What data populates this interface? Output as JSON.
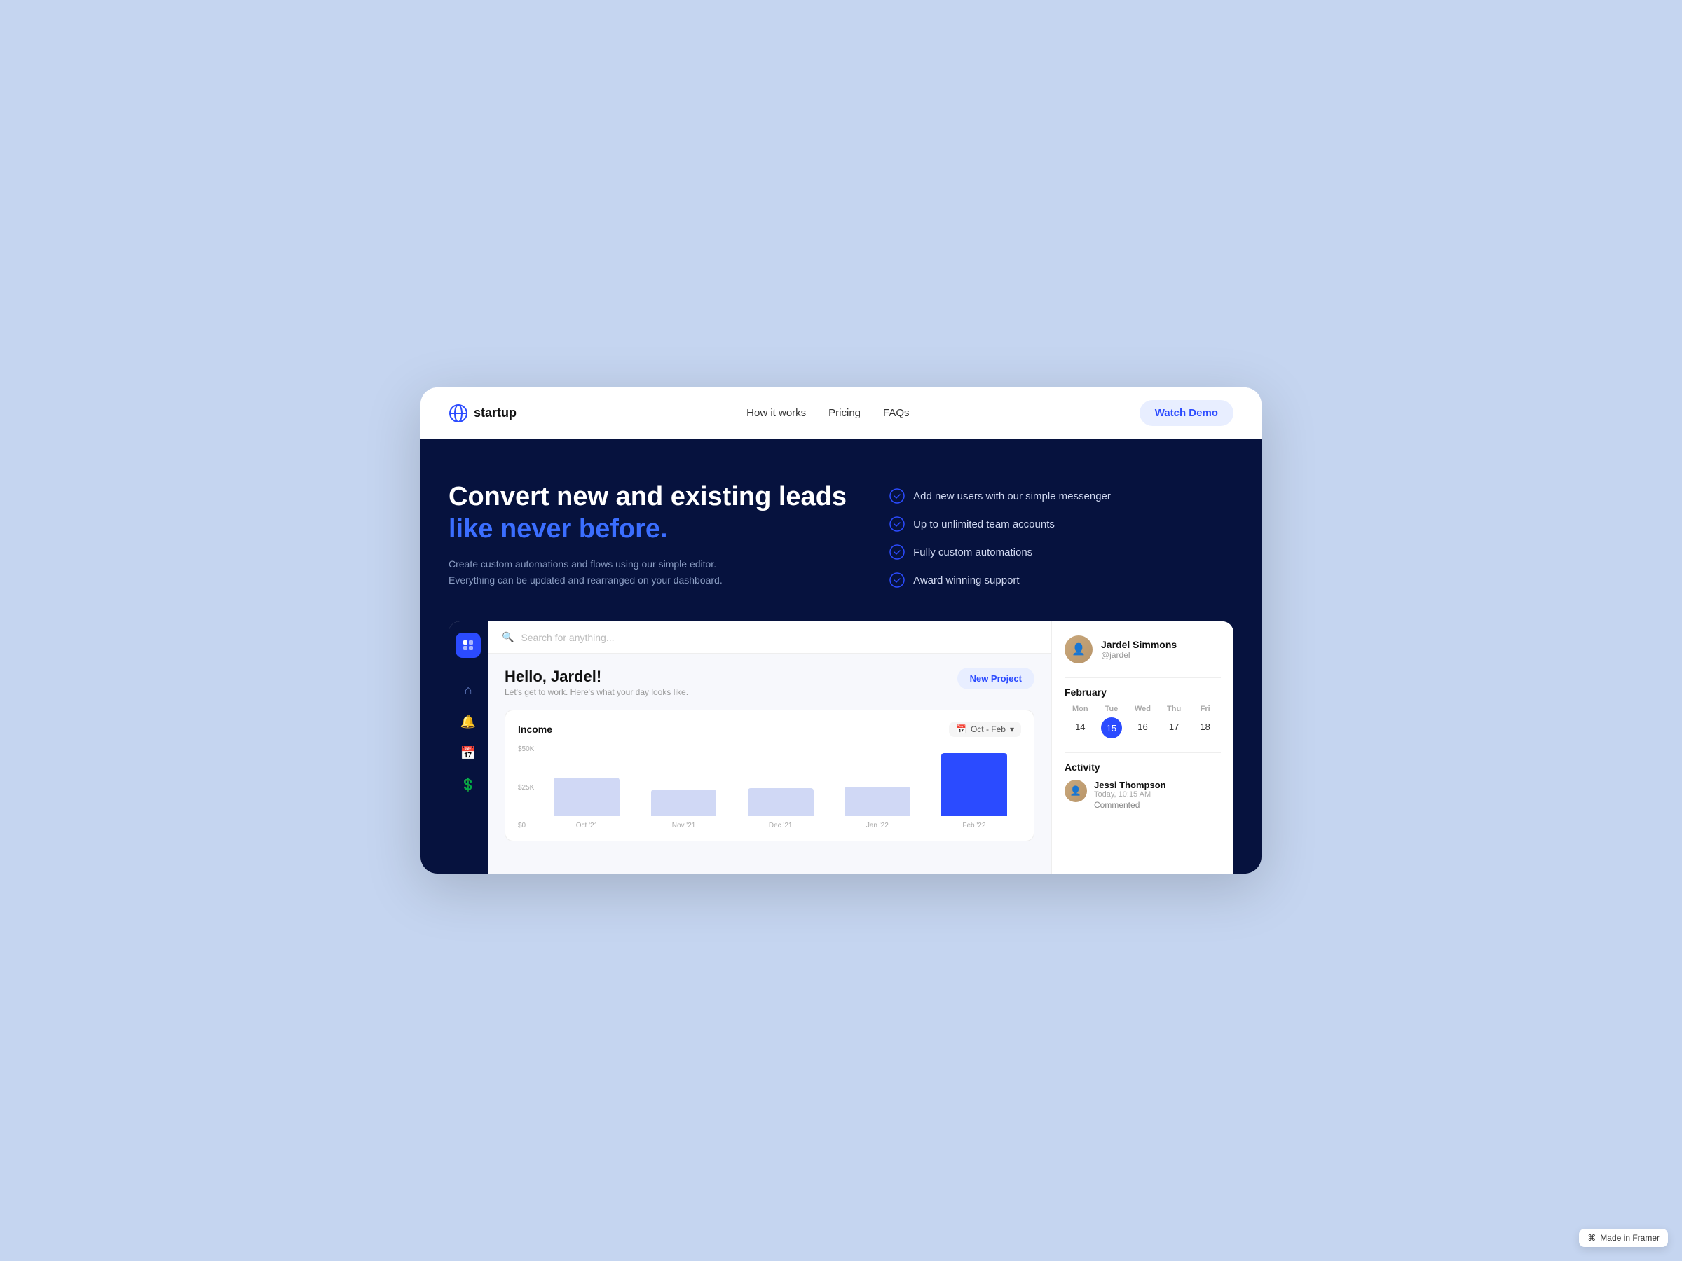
{
  "navbar": {
    "logo_text": "startup",
    "nav_items": [
      {
        "label": "How it works",
        "href": "#"
      },
      {
        "label": "Pricing",
        "href": "#"
      },
      {
        "label": "FAQs",
        "href": "#"
      }
    ],
    "cta_label": "Watch Demo"
  },
  "hero": {
    "title_line1": "Convert new and existing leads",
    "title_line2": "like never before.",
    "description": "Create custom automations and flows using our simple editor. Everything can be updated and rearranged on your dashboard.",
    "features": [
      "Add new users with our simple messenger",
      "Up to unlimited team accounts",
      "Fully custom automations",
      "Award winning support"
    ]
  },
  "dashboard": {
    "search_placeholder": "Search for anything...",
    "greeting": "Hello, Jardel!",
    "greeting_sub": "Let's get to work. Here's what your day looks like.",
    "new_project_label": "New Project",
    "chart": {
      "title": "Income",
      "range": "Oct - Feb",
      "y_labels": [
        "$50K",
        "$25K",
        "$0"
      ],
      "bars": [
        {
          "label": "Oct '21",
          "height": 55,
          "type": "light"
        },
        {
          "label": "Nov '21",
          "height": 38,
          "type": "light"
        },
        {
          "label": "Dec '21",
          "height": 40,
          "type": "light"
        },
        {
          "label": "Jan '22",
          "height": 42,
          "type": "light"
        },
        {
          "label": "Feb '22",
          "height": 90,
          "type": "blue"
        }
      ]
    },
    "profile": {
      "name": "Jardel Simmons",
      "handle": "@jardel"
    },
    "calendar": {
      "month": "February",
      "day_headers": [
        "Mon",
        "Tue",
        "Wed",
        "Thu",
        "Fri"
      ],
      "days": [
        "14",
        "15",
        "16",
        "17",
        "18"
      ],
      "active_day": "15"
    },
    "activity": {
      "title": "Activity",
      "items": [
        {
          "name": "Jessi Thompson",
          "time": "Today, 10:15 AM",
          "action": "Commented"
        }
      ]
    }
  },
  "framer_badge": "Made in Framer"
}
